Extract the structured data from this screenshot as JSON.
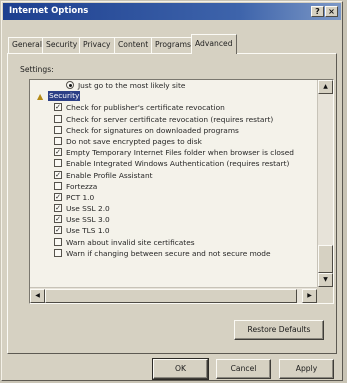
{
  "window": {
    "title": "Internet Options",
    "help_label": "?",
    "close_label": "×"
  },
  "tabs": [
    "General",
    "Security",
    "Privacy",
    "Content",
    "Programs",
    "Advanced"
  ],
  "active_tab": "Advanced",
  "settings_label": "Settings:",
  "settings_list": {
    "radio_item": {
      "label": "Just go to the most likely site",
      "selected": true
    },
    "group": {
      "label": "Security",
      "icon": "lock-icon"
    },
    "items": [
      {
        "label": "Check for publisher's certificate revocation",
        "checked": true
      },
      {
        "label": "Check for server certificate revocation (requires restart)",
        "checked": false
      },
      {
        "label": "Check for signatures on downloaded programs",
        "checked": false
      },
      {
        "label": "Do not save encrypted pages to disk",
        "checked": false
      },
      {
        "label": "Empty Temporary Internet Files folder when browser is closed",
        "checked": true
      },
      {
        "label": "Enable Integrated Windows Authentication (requires restart)",
        "checked": false
      },
      {
        "label": "Enable Profile Assistant",
        "checked": true
      },
      {
        "label": "Fortezza",
        "checked": false
      },
      {
        "label": "PCT 1.0",
        "checked": true
      },
      {
        "label": "Use SSL 2.0",
        "checked": true
      },
      {
        "label": "Use SSL 3.0",
        "checked": true
      },
      {
        "label": "Use TLS 1.0",
        "checked": true
      },
      {
        "label": "Warn about invalid site certificates",
        "checked": false
      },
      {
        "label": "Warn if changing between secure and not secure mode",
        "checked": false
      }
    ]
  },
  "buttons": {
    "restore_defaults": "Restore Defaults",
    "ok": "OK",
    "cancel": "Cancel",
    "apply": "Apply"
  },
  "check_mark": "✓",
  "colors": {
    "titlebar": "#1d3f8f",
    "selection": "#2c3f86"
  }
}
